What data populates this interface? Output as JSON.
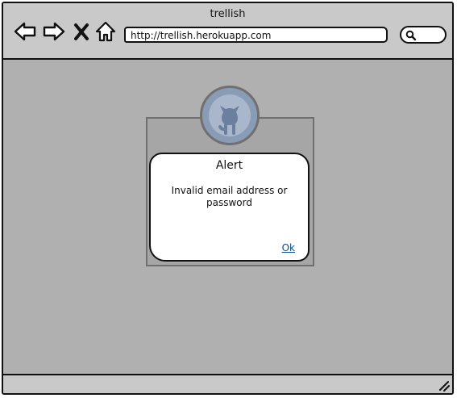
{
  "window": {
    "title": "trellish",
    "address": "http://trellish.herokuapp.com"
  },
  "toolbar": {
    "back_icon": "arrow-left-icon",
    "forward_icon": "arrow-right-icon",
    "stop_icon": "close-icon",
    "home_icon": "home-icon",
    "search_icon": "search-icon"
  },
  "login": {
    "avatar_icon": "github-octocat-icon"
  },
  "alert": {
    "title": "Alert",
    "message": "Invalid email address or password",
    "ok_label": "Ok"
  },
  "colors": {
    "content_bg": "#b0b0b0",
    "chrome_bg": "#c9c9c9",
    "avatar_bg": "#8a9bb6",
    "link": "#0b4a8b"
  }
}
